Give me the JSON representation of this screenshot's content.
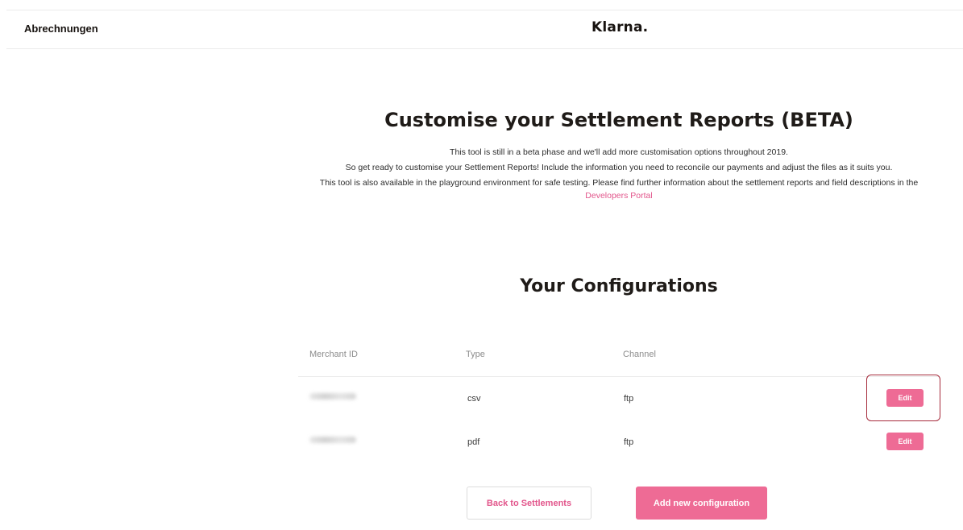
{
  "header": {
    "app_title": "Abrechnungen",
    "logo_text": "Klarna."
  },
  "intro": {
    "title": "Customise your Settlement Reports (BETA)",
    "line1": "This tool is still in a beta phase and we'll add more customisation options throughout 2019.",
    "line2": "So get ready to customise your Settlement Reports! Include the information you need to reconcile our payments and adjust the files as it suits you.",
    "line3": "This tool is also available in the playground environment for safe testing. Please find further information about the settlement reports and field descriptions in the ",
    "link_text": "Developers Portal"
  },
  "configurations": {
    "title": "Your Configurations",
    "columns": {
      "merchant_id": "Merchant ID",
      "type": "Type",
      "channel": "Channel"
    },
    "rows": [
      {
        "type": "csv",
        "channel": "ftp",
        "edit_label": "Edit",
        "highlighted": true
      },
      {
        "type": "pdf",
        "channel": "ftp",
        "edit_label": "Edit",
        "highlighted": false
      }
    ]
  },
  "actions": {
    "back_label": "Back to Settlements",
    "add_label": "Add new configuration"
  },
  "colors": {
    "accent": "#ee6b95",
    "link": "#e2558b",
    "highlight_border": "#a62b3c"
  }
}
